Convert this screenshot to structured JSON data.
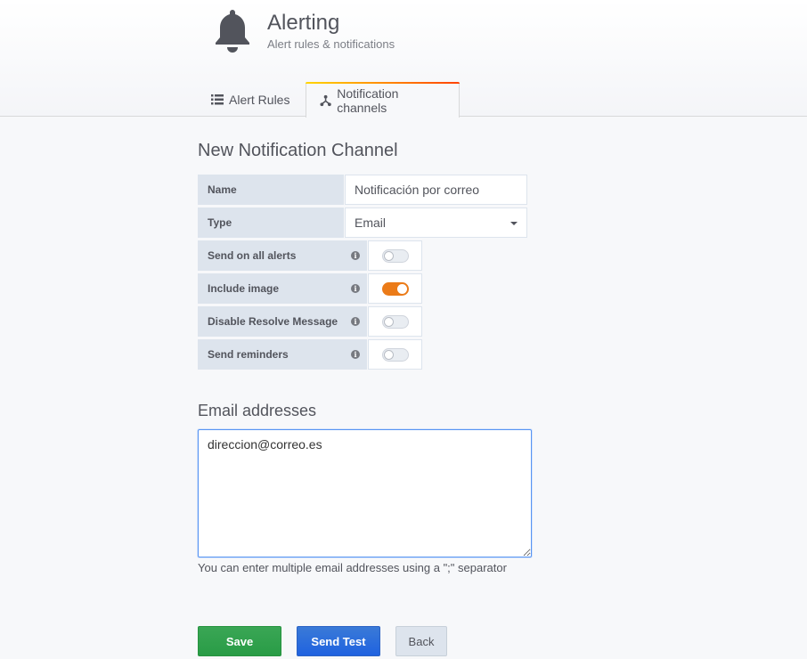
{
  "header": {
    "title": "Alerting",
    "subtitle": "Alert rules & notifications"
  },
  "tabs": [
    {
      "label": "Alert Rules",
      "icon": "list-icon",
      "active": false
    },
    {
      "label": "Notification channels",
      "icon": "share-nodes-icon",
      "active": true
    }
  ],
  "form": {
    "title": "New Notification Channel",
    "name": {
      "label": "Name",
      "value": "Notificación por correo"
    },
    "type": {
      "label": "Type",
      "value": "Email"
    },
    "toggles": [
      {
        "label": "Send on all alerts",
        "on": false
      },
      {
        "label": "Include image",
        "on": true
      },
      {
        "label": "Disable Resolve Message",
        "on": false
      },
      {
        "label": "Send reminders",
        "on": false
      }
    ]
  },
  "email": {
    "title": "Email addresses",
    "value": "direccion@correo.es",
    "help": "You can enter multiple email addresses using a \";\" separator"
  },
  "buttons": {
    "save": "Save",
    "send_test": "Send Test",
    "back": "Back"
  },
  "colors": {
    "accent_orange": "#eb7b18",
    "save_green": "#299c46",
    "test_blue": "#1f62e0"
  }
}
